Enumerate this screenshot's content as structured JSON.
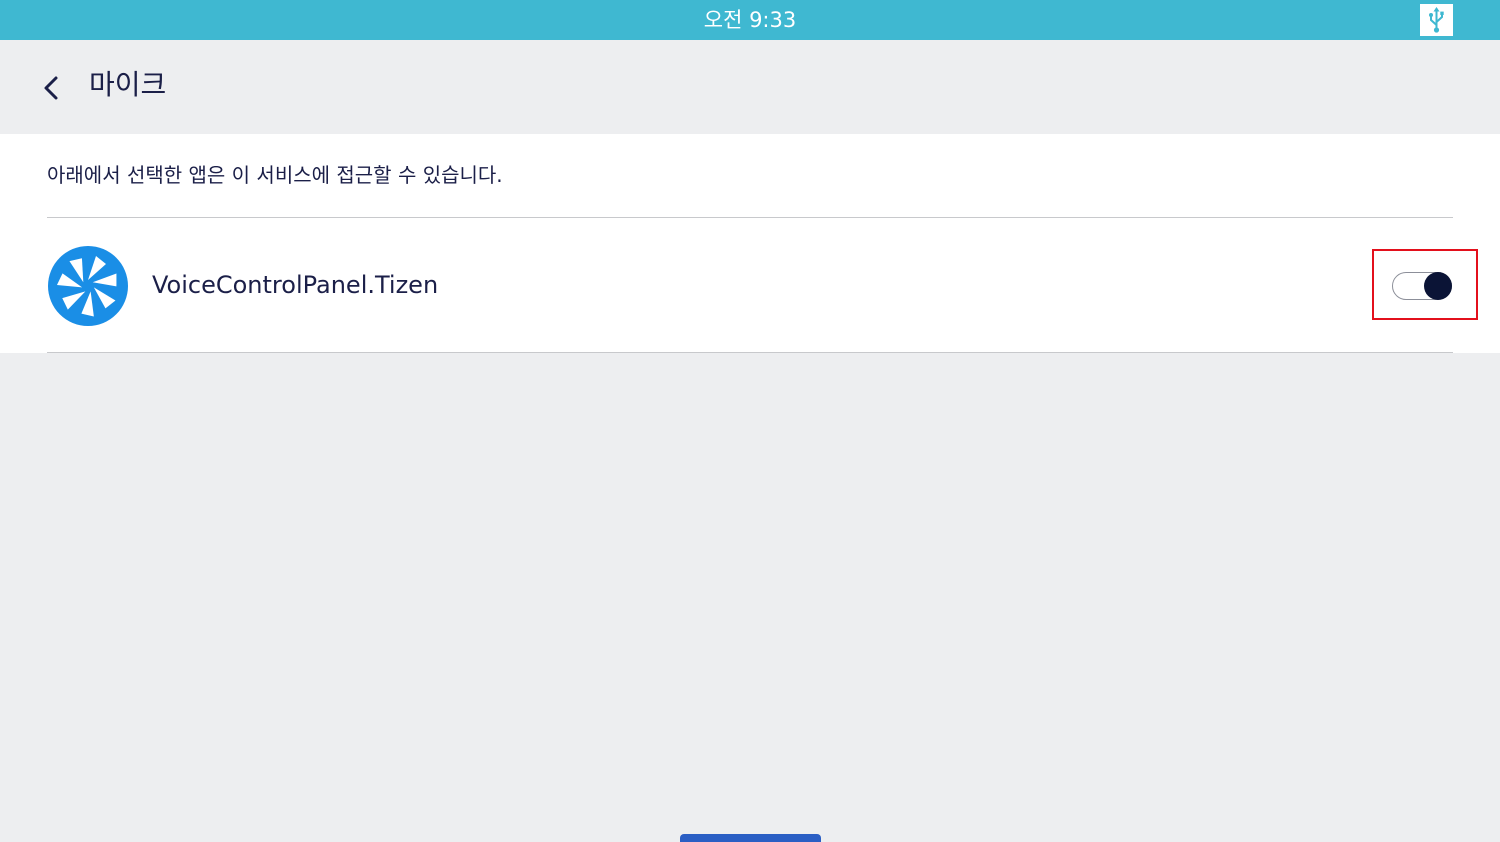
{
  "status_bar": {
    "time": "오전 9:33",
    "right_icon": "usb-icon"
  },
  "header": {
    "back_icon": "chevron-left-icon",
    "title": "마이크"
  },
  "content": {
    "description": "아래에서 선택한 앱은 이 서비스에 접근할 수 있습니다.",
    "apps": [
      {
        "name": "VoiceControlPanel.Tizen",
        "icon": "tizen-pinwheel-icon",
        "toggle_on": true
      }
    ]
  },
  "colors": {
    "status_bar": "#3fb8d1",
    "background": "#edeef0",
    "text": "#1b1f48",
    "app_icon": "#1a8ee6",
    "toggle_knob": "#0b1436",
    "highlight": "#e3101c",
    "home_indicator": "#2a5ec4"
  }
}
